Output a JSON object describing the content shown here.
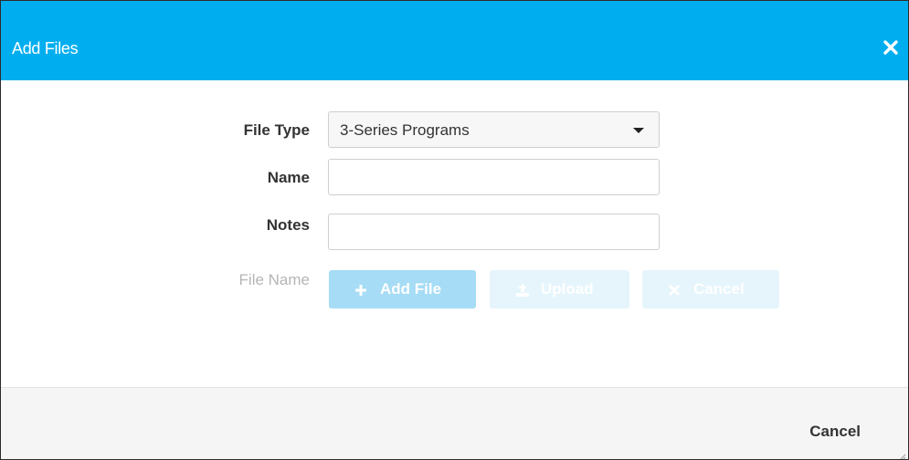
{
  "dialog": {
    "title": "Add Files",
    "close_icon": "close-icon"
  },
  "form": {
    "file_type_label": "File Type",
    "file_type_value": "3-Series Programs",
    "name_label": "Name",
    "name_value": "",
    "notes_label": "Notes",
    "notes_value": "",
    "file_name_label": "File Name"
  },
  "buttons": {
    "add_file": {
      "label": "Add File",
      "icon": "plus-icon"
    },
    "upload": {
      "label": "Upload",
      "icon": "upload-icon"
    },
    "cancel": {
      "label": "Cancel",
      "icon": "x-icon"
    }
  },
  "footer": {
    "cancel_label": "Cancel"
  },
  "colors": {
    "header": "#00aeef",
    "add_button": "#a6dcf5",
    "disabled_button": "#e6f5fc",
    "footer_bg": "#f5f5f5"
  }
}
